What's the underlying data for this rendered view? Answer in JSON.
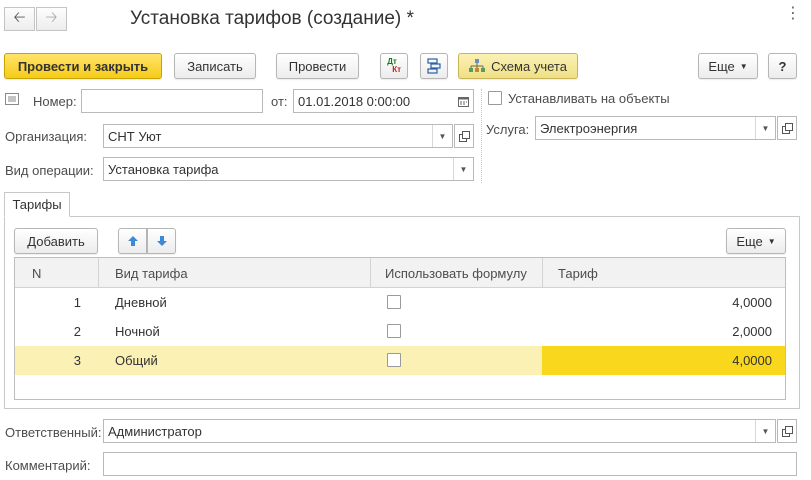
{
  "window": {
    "title": "Установка тарифов (создание) *"
  },
  "toolbar": {
    "post_close": "Провести и закрыть",
    "save": "Записать",
    "post": "Провести",
    "dtkt_top": "Дт",
    "dtkt_bottom": "Кт",
    "scheme": "Схема учета",
    "more": "Еще",
    "help": "?"
  },
  "form": {
    "number_label": "Номер:",
    "number_value": "",
    "date_label": "от:",
    "date_value": "01.01.2018  0:00:00",
    "org_label": "Организация:",
    "org_value": "СНТ Уют",
    "operation_label": "Вид операции:",
    "operation_value": "Установка тарифа",
    "set_on_objects_label": "Устанавливать на объекты",
    "service_label": "Услуга:",
    "service_value": "Электроэнергия",
    "responsible_label": "Ответственный:",
    "responsible_value": "Администратор",
    "comment_label": "Комментарий:",
    "comment_value": ""
  },
  "tabs": {
    "tariffs": "Тарифы"
  },
  "table_toolbar": {
    "add": "Добавить",
    "more": "Еще"
  },
  "table": {
    "columns": [
      "N",
      "Вид тарифа",
      "Использовать формулу",
      "Тариф"
    ],
    "rows": [
      {
        "n": "1",
        "type": "Дневной",
        "use_formula": false,
        "rate": "4,0000"
      },
      {
        "n": "2",
        "type": "Ночной",
        "use_formula": false,
        "rate": "2,0000"
      },
      {
        "n": "3",
        "type": "Общий",
        "use_formula": false,
        "rate": "4,0000"
      }
    ],
    "selected_row": 3
  },
  "colors": {
    "accent_yellow": "#f6cc18",
    "selected_row": "#fbf1b4",
    "selected_cell": "#f9d71c",
    "arrow_blue": "#3a8ad8"
  }
}
